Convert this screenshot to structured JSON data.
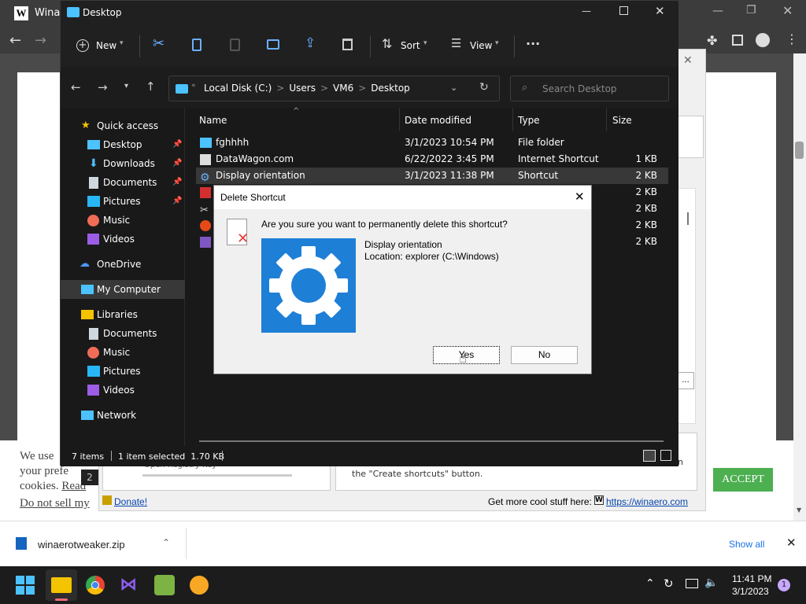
{
  "browser": {
    "tab_title": "Winae",
    "tab_logo_letter": "W"
  },
  "explorer": {
    "title": "Desktop",
    "toolbar": {
      "new_label": "New",
      "sort_label": "Sort",
      "view_label": "View",
      "more_label": "···"
    },
    "address": {
      "crumbs": [
        "Local Disk (C:)",
        "Users",
        "VM6",
        "Desktop"
      ],
      "separator": ">",
      "chevrons": "«"
    },
    "search_placeholder": "Search Desktop",
    "columns": {
      "name": "Name",
      "date": "Date modified",
      "type": "Type",
      "size": "Size"
    },
    "files": [
      {
        "name": "fghhhh",
        "date": "3/1/2023 10:54 PM",
        "type": "File folder",
        "size": ""
      },
      {
        "name": "DataWagon.com",
        "date": "6/22/2022 3:45 PM",
        "type": "Internet Shortcut",
        "size": "1 KB"
      },
      {
        "name": "Display orientation",
        "date": "3/1/2023 11:38 PM",
        "type": "Shortcut",
        "size": "2 KB"
      },
      {
        "name": "",
        "date": "",
        "type": "",
        "size": "2 KB"
      },
      {
        "name": "",
        "date": "",
        "type": "",
        "size": "2 KB"
      },
      {
        "name": "",
        "date": "",
        "type": "",
        "size": "2 KB"
      },
      {
        "name": "",
        "date": "",
        "type": "",
        "size": "2 KB"
      }
    ],
    "nav": {
      "quick_access": "Quick access",
      "quick_items": [
        "Desktop",
        "Downloads",
        "Documents",
        "Pictures",
        "Music",
        "Videos"
      ],
      "onedrive": "OneDrive",
      "my_computer": "My Computer",
      "libraries": "Libraries",
      "library_items": [
        "Documents",
        "Music",
        "Pictures",
        "Videos"
      ],
      "network": "Network"
    },
    "status": {
      "items": "7 items",
      "selected": "1 item selected  1.70 KB"
    }
  },
  "dialog": {
    "title": "Delete Shortcut",
    "question": "Are you sure you want to permanently delete this shortcut?",
    "item_name": "Display orientation",
    "item_location": "Location: explorer (C:\\Windows)",
    "yes_label": "Yes",
    "no_label": "No"
  },
  "tweaker": {
    "tab_num": "2",
    "open_registry": "Open Registry Key",
    "create_shortcuts": "the \"Create shortcuts\" button.",
    "donate": "Donate!",
    "more_stuff": "Get more cool stuff here:",
    "winaero_url": "https://winaero.com",
    "ellipsis": "...",
    "n_char": "n"
  },
  "cookie": {
    "line1": "We use",
    "line2": "your prefe",
    "line3": "cookies.",
    "read": "Read",
    "donotsell": "Do not sell my",
    "accept": "ACCEPT"
  },
  "downloads": {
    "file": "winaerotweaker.zip",
    "show_all": "Show all"
  },
  "taskbar": {
    "time": "11:41 PM",
    "date": "3/1/2023",
    "badge": "1"
  },
  "colors": {
    "accent": "#0078d4",
    "accept_green": "#4caf50",
    "shortcut_blue": "#1e7fd7"
  }
}
